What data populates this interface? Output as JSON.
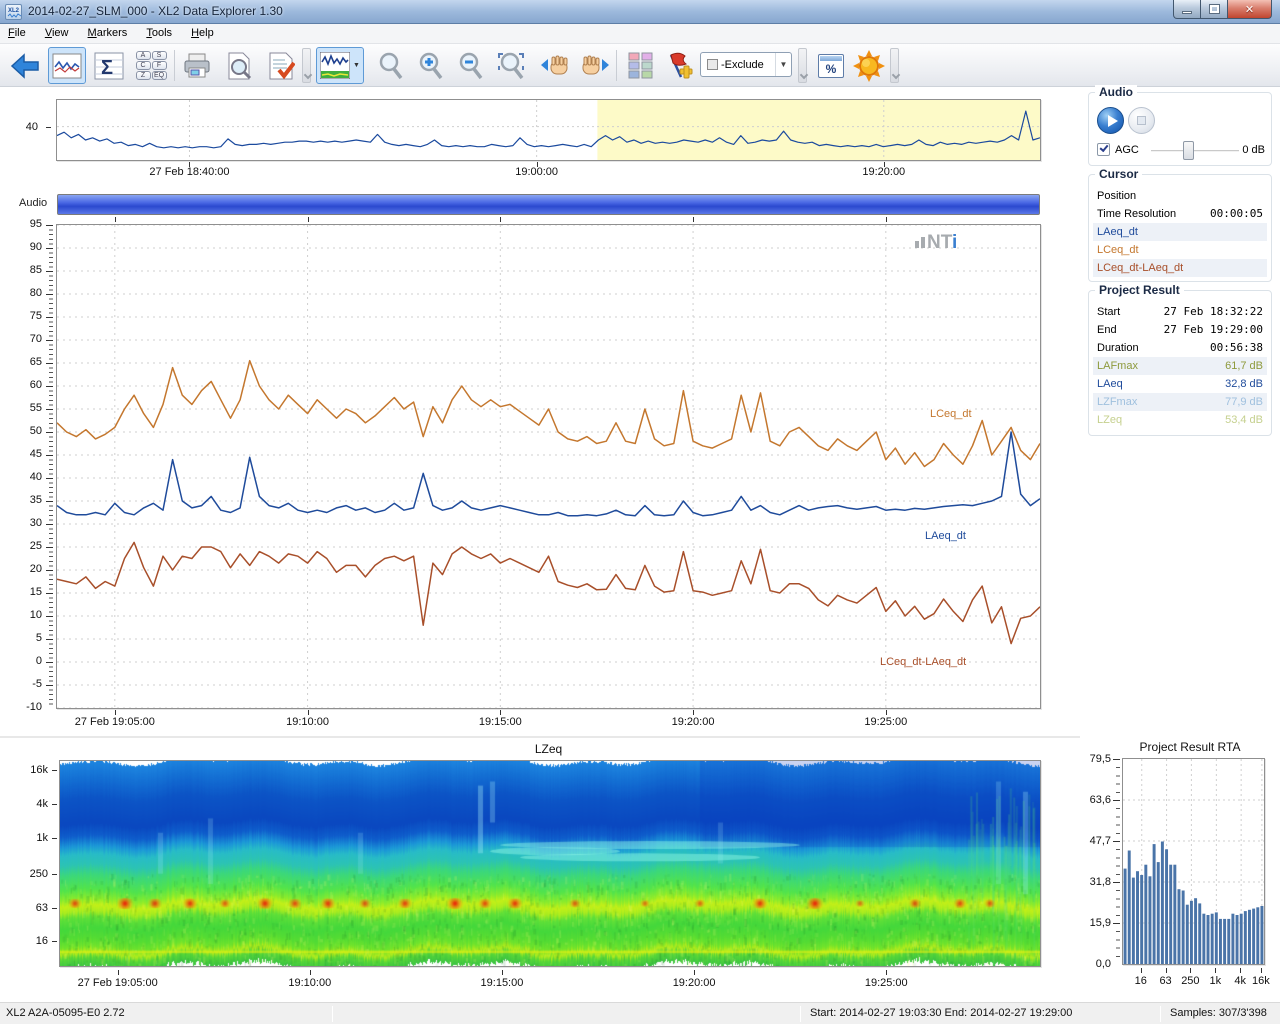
{
  "window": {
    "title": "2014-02-27_SLM_000 - XL2 Data Explorer 1.30"
  },
  "menu": {
    "items": [
      "File",
      "View",
      "Markers",
      "Tools",
      "Help"
    ]
  },
  "toolbar": {
    "sigma_glyph": "Σ",
    "percent_glyph": "%",
    "letter_boxes": [
      "A",
      "S",
      "C",
      "F",
      "Z",
      "EQ"
    ],
    "marker_grid_colors": [
      "#f2a8b8",
      "#e2b0e8",
      "#b4bce8",
      "#bcd8cc",
      "#9cb4dc",
      "#b8d8a8"
    ],
    "exclude_dropdown": {
      "value": "-Exclude"
    },
    "caret": "▼"
  },
  "audio_panel": {
    "title": "Audio",
    "agc_label": "AGC",
    "gain_value": "0 dB"
  },
  "cursor_panel": {
    "title": "Cursor",
    "rows": [
      {
        "label": "Position",
        "value": ""
      },
      {
        "label": "Time Resolution",
        "value": "00:00:05"
      },
      {
        "label": "LAeq_dt",
        "value": "",
        "color": "#1f4b9b"
      },
      {
        "label": "LCeq_dt",
        "value": "",
        "color": "#c4772e"
      },
      {
        "label": "LCeq_dt-LAeq_dt",
        "value": "",
        "color": "#a84f2a"
      }
    ]
  },
  "project_panel": {
    "title": "Project Result",
    "rows": [
      {
        "label": "Start",
        "value": "27 Feb 18:32:22",
        "mono": true,
        "color": "#000000"
      },
      {
        "label": "End",
        "value": "27 Feb 19:29:00",
        "mono": true,
        "color": "#000000"
      },
      {
        "label": "Duration",
        "value": "00:56:38",
        "mono": true,
        "color": "#000000"
      },
      {
        "label": "LAFmax",
        "value": "61,7 dB",
        "color": "#8e9a3c"
      },
      {
        "label": "LAeq",
        "value": "32,8 dB",
        "color": "#1f4b9b"
      },
      {
        "label": "LZFmax",
        "value": "77,9 dB",
        "color": "#9fc0de"
      },
      {
        "label": "LZeq",
        "value": "53,4 dB",
        "color": "#c5d08e"
      }
    ]
  },
  "audio_strip": {
    "label": "Audio"
  },
  "watermark": {
    "text": "NT",
    "i": "i"
  },
  "status_bar": {
    "device": "XL2 A2A-05095-E0 2.72",
    "range": "Start: 2014-02-27 19:03:30 End: 2014-02-27 19:29:00",
    "samples": "Samples: 307/3'398"
  },
  "chart_data": [
    {
      "id": "overview",
      "type": "line",
      "ylabel_tick": "40",
      "ylim": [
        25,
        52
      ],
      "t_total_min": 56.633,
      "xticks": [
        {
          "t": 7.633,
          "label": "27 Feb 18:40:00"
        },
        {
          "t": 27.633,
          "label": "19:00:00"
        },
        {
          "t": 47.633,
          "label": "19:20:00"
        }
      ],
      "selection_min": [
        31.133,
        56.633
      ],
      "selection_color": "#fdfac8",
      "line_color": "#1b4a9e",
      "values": [
        36,
        37.5,
        35,
        36.5,
        34,
        35,
        33.5,
        34.5,
        32.5,
        33,
        31.5,
        32,
        31,
        32.5,
        31,
        30.5,
        31,
        30.5,
        31,
        30.5,
        31,
        31,
        30.5,
        31,
        34.5,
        32,
        31.5,
        32,
        32,
        32.5,
        32,
        32.5,
        33,
        33,
        33.5,
        33.5,
        33,
        33.5,
        33,
        33.5,
        33,
        33.5,
        34,
        33.5,
        33,
        36.5,
        33,
        32,
        31.5,
        32,
        31.5,
        31,
        32,
        34,
        31.5,
        31,
        31.5,
        31,
        31.5,
        31,
        31,
        32,
        31.5,
        31,
        31.5,
        35,
        32,
        31,
        31.5,
        31,
        31.5,
        32,
        31.5,
        31,
        32,
        31,
        34,
        36,
        34,
        35.5,
        33,
        34,
        32.5,
        33.5,
        32.5,
        33,
        32.5,
        33,
        34,
        33.5,
        33,
        34,
        33,
        35,
        33,
        32,
        36,
        32.5,
        33,
        34,
        33.5,
        34,
        38,
        34,
        33,
        32.5,
        33,
        31.5,
        32,
        31.5,
        31,
        31.5,
        31,
        31.5,
        31,
        32,
        31,
        31.5,
        32,
        31.5,
        32,
        34,
        32,
        31.5,
        33,
        32,
        32.5,
        32,
        33,
        32.5,
        33,
        33.5,
        33,
        34,
        36,
        34,
        47,
        34,
        35
      ]
    },
    {
      "id": "main",
      "type": "line",
      "ylim": [
        -10,
        95
      ],
      "ytick_step": 5,
      "t_start_min": 3.5,
      "t_end_min": 29,
      "xticks": [
        {
          "t": 5,
          "label": "27 Feb 19:05:00"
        },
        {
          "t": 10,
          "label": "19:10:00"
        },
        {
          "t": 15,
          "label": "19:15:00"
        },
        {
          "t": 20,
          "label": "19:20:00"
        },
        {
          "t": 25,
          "label": "19:25:00"
        }
      ],
      "series": [
        {
          "name": "LCeq_dt",
          "color": "#c4772e",
          "values": [
            52,
            50,
            49,
            50.5,
            48.5,
            49.5,
            51,
            55,
            58,
            54,
            51,
            56,
            64,
            58,
            56,
            59,
            61,
            57,
            53,
            57,
            65.5,
            60,
            57,
            55,
            58,
            56,
            54,
            57,
            55,
            53,
            55,
            54,
            52,
            53.5,
            55.5,
            57.5,
            55,
            56.5,
            49,
            55.5,
            52,
            57,
            60,
            57,
            55.5,
            57,
            55.5,
            56,
            54.5,
            53,
            51.5,
            55,
            50,
            48.5,
            48,
            49,
            47.5,
            48,
            52,
            48,
            47.5,
            55,
            48.5,
            47,
            47.5,
            59,
            48,
            47,
            46.5,
            47.5,
            48.5,
            58,
            50,
            58.5,
            48,
            47,
            50,
            51,
            49,
            47,
            46,
            48.5,
            47,
            46,
            48,
            50,
            44,
            46.5,
            43,
            45.5,
            42.5,
            44,
            47.5,
            45,
            43,
            47,
            52.5,
            45,
            48,
            51,
            46,
            44,
            47.5
          ]
        },
        {
          "name": "LAeq_dt",
          "color": "#1f4b9b",
          "values": [
            34,
            32.5,
            32,
            32,
            32.5,
            32,
            34.5,
            32.5,
            32,
            33.5,
            34.5,
            33,
            44,
            35,
            33.5,
            34,
            36,
            33,
            32.5,
            33.5,
            44.5,
            36,
            34,
            33.5,
            34.5,
            33,
            32.5,
            33,
            32.5,
            33.5,
            34,
            33,
            33.5,
            32.5,
            33,
            34.5,
            33,
            33.5,
            41,
            34,
            33,
            33.5,
            35,
            33.5,
            33,
            33.5,
            34,
            33.5,
            33,
            32.5,
            32,
            32,
            32.5,
            31.8,
            31.8,
            32,
            31.8,
            32.2,
            33,
            32,
            31.8,
            34,
            32,
            31.8,
            32,
            35,
            32.5,
            31.8,
            32,
            32.5,
            33,
            36,
            33,
            34,
            32.5,
            32,
            33,
            34,
            33,
            33.5,
            33.8,
            34,
            33.5,
            33.2,
            33.5,
            33.8,
            33,
            33.2,
            33,
            33.4,
            33.2,
            33.5,
            33.8,
            34,
            34.2,
            34,
            34.5,
            35,
            36,
            50,
            36.5,
            34,
            35.5
          ]
        },
        {
          "name": "LCeq_dt-LAeq_dt",
          "color": "#a84f2a",
          "values": [
            18,
            17.5,
            17,
            18.5,
            16,
            17.5,
            16.5,
            22.5,
            26,
            20.5,
            16.5,
            23,
            20,
            23,
            22.5,
            25,
            25,
            24,
            20.5,
            23.5,
            21,
            24,
            23,
            21.5,
            23.5,
            23,
            21.5,
            24,
            22.5,
            19.5,
            21,
            21,
            18.5,
            21,
            22.5,
            23,
            22,
            23,
            8,
            21.5,
            19,
            23.5,
            25,
            23.5,
            22.5,
            23.5,
            21.5,
            22.5,
            21.5,
            20.5,
            19.5,
            23,
            17.5,
            16.7,
            16.2,
            17,
            15.7,
            15.8,
            19,
            16,
            15.7,
            21,
            16.5,
            15.2,
            15.5,
            24,
            15.5,
            15.2,
            14.5,
            15,
            15.5,
            22,
            17,
            24.5,
            15.5,
            15,
            17,
            17,
            16,
            13.5,
            12.2,
            14.5,
            13.5,
            12.8,
            14.5,
            16.2,
            11,
            13.3,
            10,
            12.1,
            9.3,
            10.5,
            13.7,
            11,
            8.8,
            13.5,
            16.5,
            8.5,
            12,
            4,
            9.5,
            10,
            12
          ]
        }
      ]
    },
    {
      "id": "spectrogram",
      "type": "heatmap",
      "title": "LZeq",
      "yticks": [
        "16k",
        "4k",
        "1k",
        "250",
        "63",
        "16"
      ],
      "ytick_fracs": [
        0.05,
        0.215,
        0.38,
        0.555,
        0.72,
        0.885
      ],
      "t_start_min": 3.5,
      "t_end_min": 29,
      "xticks": [
        {
          "t": 5,
          "label": "27 Feb 19:05:00"
        },
        {
          "t": 10,
          "label": "19:10:00"
        },
        {
          "t": 15,
          "label": "19:15:00"
        },
        {
          "t": 20,
          "label": "19:20:00"
        },
        {
          "t": 25,
          "label": "19:25:00"
        }
      ],
      "palette": [
        [
          0,
          "#1e86e0"
        ],
        [
          0.08,
          "#1470d4"
        ],
        [
          0.18,
          "#0c54c6"
        ],
        [
          0.3,
          "#0a48c0"
        ],
        [
          0.36,
          "#0f5ecc"
        ],
        [
          0.41,
          "#1c96d8"
        ],
        [
          0.45,
          "#28bcc8"
        ],
        [
          0.5,
          "#2cc4b4"
        ],
        [
          0.55,
          "#3cd87c"
        ],
        [
          0.62,
          "#52e44c"
        ],
        [
          0.67,
          "#8cec2c"
        ],
        [
          0.7,
          "#c4f018"
        ],
        [
          0.73,
          "#a8ec20"
        ],
        [
          0.76,
          "#60e038"
        ],
        [
          0.81,
          "#44d83c"
        ],
        [
          0.86,
          "#54dc34"
        ],
        [
          0.9,
          "#70e42c"
        ],
        [
          0.93,
          "#b4ec1c"
        ],
        [
          0.955,
          "#58d838"
        ],
        [
          1,
          "#3cc444"
        ]
      ],
      "hotspots": [
        [
          15,
          0.8
        ],
        [
          65,
          1
        ],
        [
          95,
          0.85
        ],
        [
          130,
          0.9
        ],
        [
          165,
          0.7
        ],
        [
          205,
          0.95
        ],
        [
          235,
          0.8
        ],
        [
          268,
          0.9
        ],
        [
          305,
          0.75
        ],
        [
          345,
          0.85
        ],
        [
          395,
          1
        ],
        [
          425,
          0.8
        ],
        [
          455,
          0.9
        ],
        [
          515,
          0.7
        ],
        [
          585,
          0.6
        ],
        [
          640,
          0.65
        ],
        [
          700,
          0.9
        ],
        [
          755,
          1
        ],
        [
          800,
          0.6
        ],
        [
          855,
          0.75
        ],
        [
          900,
          0.8
        ],
        [
          930,
          0.7
        ]
      ],
      "streaks": [
        [
          100,
          0.35,
          0.55,
          0.22
        ],
        [
          150,
          0.28,
          0.6,
          0.2
        ],
        [
          300,
          0.35,
          0.55,
          0.18
        ],
        [
          420,
          0.12,
          0.45,
          0.35
        ],
        [
          432,
          0.1,
          0.3,
          0.28
        ],
        [
          660,
          0.3,
          0.5,
          0.18
        ],
        [
          938,
          0.1,
          0.6,
          0.22
        ],
        [
          965,
          0.15,
          0.65,
          0.28
        ]
      ],
      "cyan_bands": [
        [
          430,
          560,
          0.44
        ],
        [
          440,
          740,
          0.41
        ],
        [
          460,
          700,
          0.47
        ]
      ]
    },
    {
      "id": "rta",
      "type": "bar",
      "title": "Project Result RTA",
      "yticks": [
        "79,5",
        "63,6",
        "47,7",
        "31,8",
        "15,9",
        "0,0"
      ],
      "ylim": [
        0,
        79.5
      ],
      "xticks": [
        "16",
        "63",
        "250",
        "1k",
        "4k",
        "16k"
      ],
      "xtick_fracs": [
        0.133,
        0.309,
        0.485,
        0.662,
        0.838,
        0.985
      ],
      "bar_color": "#4a74a8",
      "values": [
        37,
        44,
        33.5,
        36,
        34.5,
        38.5,
        34,
        46.5,
        39.5,
        47.5,
        44.5,
        38.5,
        38.5,
        29,
        28.5,
        23,
        24.5,
        25.5,
        23.5,
        19.5,
        19,
        19.5,
        20,
        17.5,
        17.5,
        17.5,
        19.5,
        19,
        19.5,
        20.5,
        21,
        21.5,
        22,
        22.5
      ]
    }
  ]
}
